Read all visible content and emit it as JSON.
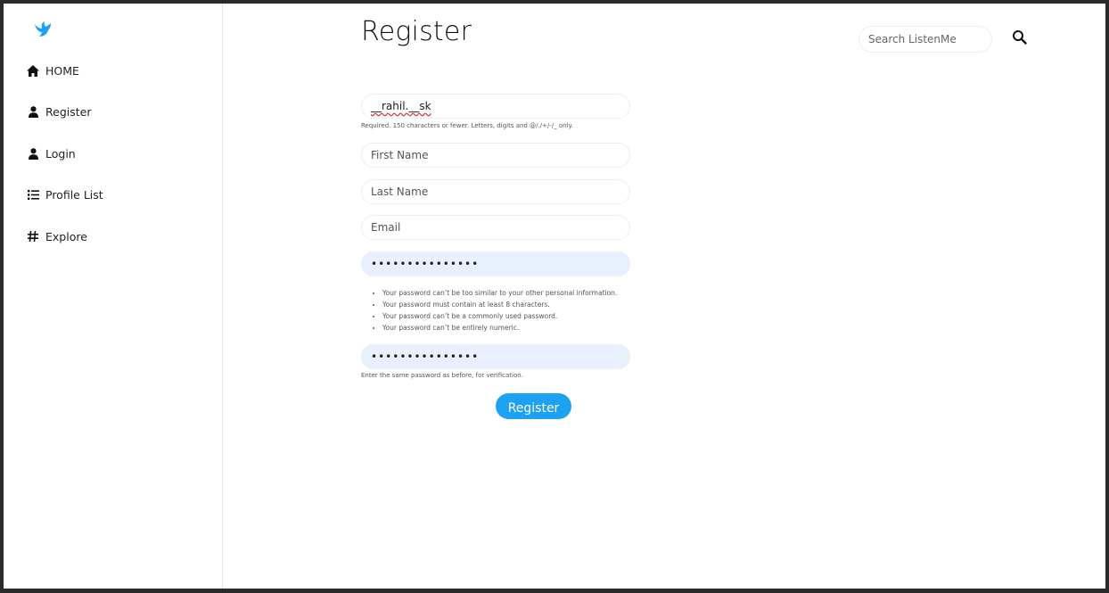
{
  "app": {
    "brand_color": "#1da1f2",
    "logo_icon": "bird-icon"
  },
  "sidebar": {
    "items": [
      {
        "label": "HOME",
        "icon": "home-icon"
      },
      {
        "label": "Register",
        "icon": "user-icon"
      },
      {
        "label": "Login",
        "icon": "user-icon"
      },
      {
        "label": "Profile List",
        "icon": "list-icon"
      },
      {
        "label": "Explore",
        "icon": "hashtag-icon"
      }
    ]
  },
  "header": {
    "title": "Register",
    "search_placeholder": "Search ListenMe",
    "search_icon": "search-icon"
  },
  "form": {
    "username_value": "__rahil.__sk",
    "username_help": "Required. 150 characters or fewer. Letters, digits and @/./+/-/_ only.",
    "first_name_placeholder": "First Name",
    "last_name_placeholder": "Last Name",
    "email_placeholder": "Email",
    "password_value": "•••••••••••••••",
    "password_rules": [
      "Your password can’t be too similar to your other personal information.",
      "Your password must contain at least 8 characters.",
      "Your password can’t be a commonly used password.",
      "Your password can’t be entirely numeric."
    ],
    "password_confirm_value": "•••••••••••••••",
    "password_confirm_help": "Enter the same password as before, for verification.",
    "submit_label": "Register",
    "autofill_color": "#e8f0fe"
  }
}
